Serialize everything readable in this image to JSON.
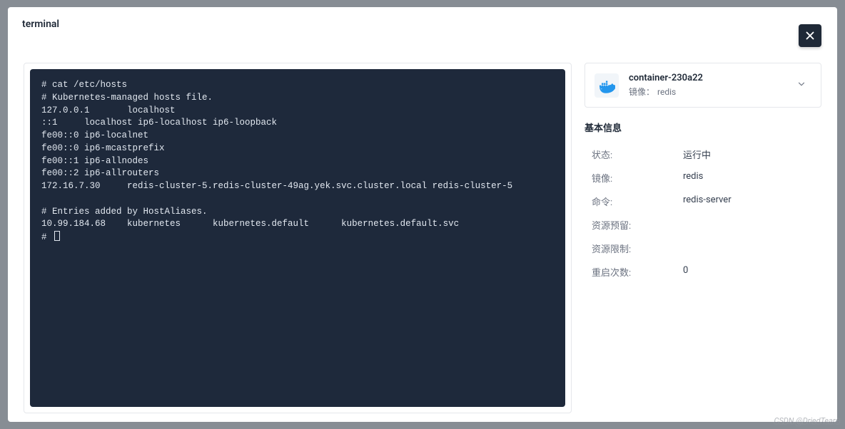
{
  "header": {
    "title": "terminal"
  },
  "terminal": {
    "output": "# cat /etc/hosts\n# Kubernetes-managed hosts file.\n127.0.0.1       localhost\n::1     localhost ip6-localhost ip6-loopback\nfe00::0 ip6-localnet\nfe00::0 ip6-mcastprefix\nfe00::1 ip6-allnodes\nfe00::2 ip6-allrouters\n172.16.7.30     redis-cluster-5.redis-cluster-49ag.yek.svc.cluster.local redis-cluster-5\n\n# Entries added by HostAliases.\n10.99.184.68    kubernetes      kubernetes.default      kubernetes.default.svc",
    "prompt": "# "
  },
  "container": {
    "name": "container-230a22",
    "image_label": "镜像：",
    "image": "redis"
  },
  "basic_info": {
    "title": "基本信息",
    "rows": [
      {
        "key": "状态:",
        "value": "运行中"
      },
      {
        "key": "镜像:",
        "value": "redis"
      },
      {
        "key": "命令:",
        "value": "redis-server"
      },
      {
        "key": "资源预留:",
        "value": ""
      },
      {
        "key": "资源限制:",
        "value": ""
      },
      {
        "key": "重启次数:",
        "value": "0"
      }
    ]
  },
  "watermark": "CSDN @DriedTears"
}
